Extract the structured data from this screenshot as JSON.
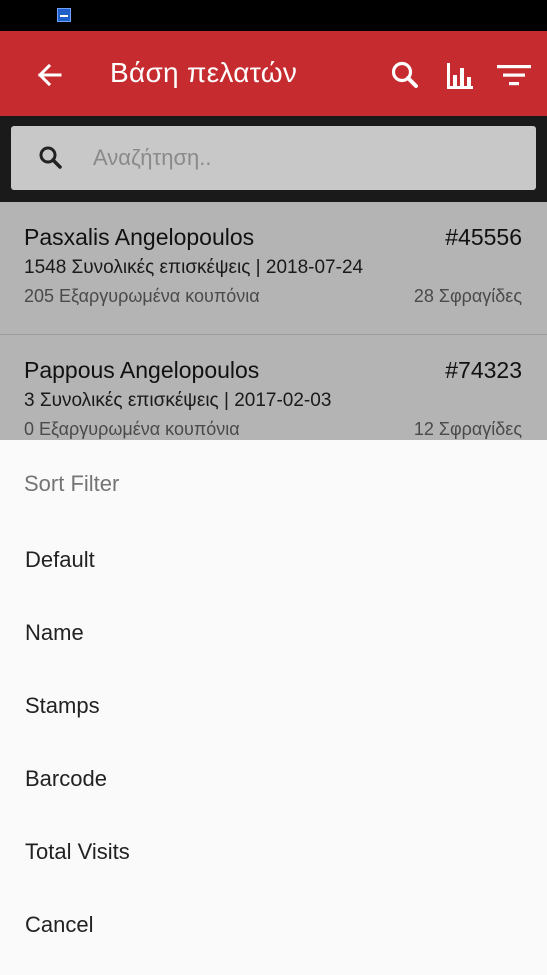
{
  "toolbar": {
    "title": "Βάση πελατών",
    "color": "#c62c2f",
    "icons": [
      "arrow-back-icon",
      "search-icon",
      "bar-chart-icon",
      "filter-icon"
    ]
  },
  "search": {
    "placeholder": "Αναζήτηση..",
    "value": ""
  },
  "customers": [
    {
      "name": "Pasxalis Angelopoulos",
      "number": "#45556",
      "visits": "1548 Συνολικές επισκέψεις | 2018-07-24",
      "coupons": "205 Εξαργυρωμένα κουπόνια",
      "stamps": "28 Σφραγίδες"
    },
    {
      "name": "Pappous Angelopoulos",
      "number": "#74323",
      "visits": "3 Συνολικές επισκέψεις | 2017-02-03",
      "coupons": "0 Εξαργυρωμένα κουπόνια",
      "stamps": "12 Σφραγίδες"
    }
  ],
  "sort_sheet": {
    "title": "Sort Filter",
    "options": [
      "Default",
      "Name",
      "Stamps",
      "Barcode",
      "Total Visits",
      "Cancel"
    ]
  }
}
